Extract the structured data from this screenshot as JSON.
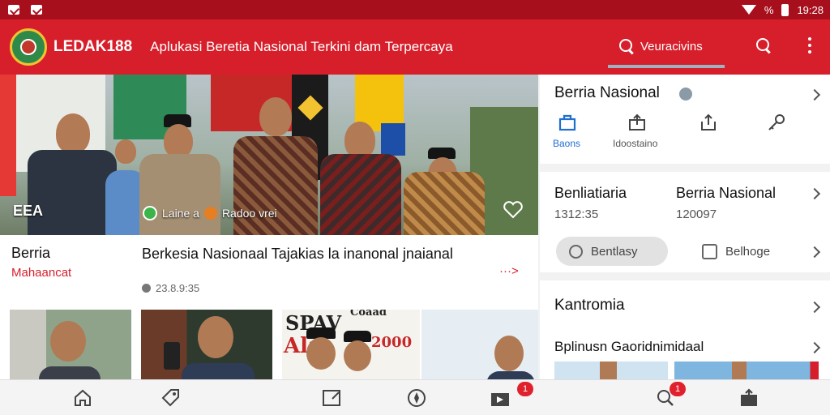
{
  "status_bar": {
    "time": "19:28",
    "network": "%"
  },
  "app_bar": {
    "brand": "LEDAK188",
    "tagline": "Aplukasi Beretia Nasional Terkini dam Terpercaya",
    "search_label": "Veuracivins"
  },
  "hero": {
    "badge": "EEA",
    "chip_label": "Laine a",
    "chip_label_2": "Radoo vrei"
  },
  "headline": {
    "category_title": "Berria",
    "category_sub": "Mahaancat",
    "title": "Berkesia Nasionaal Tajakias la inanonal jnaianal",
    "date": "23.8.9:35",
    "more": "···>"
  },
  "thumbnails": {
    "poster_line1": "SPAV",
    "poster_line2": "Ala",
    "poster_line3": "Coaad",
    "poster_line4": "2000"
  },
  "panel": {
    "section1": {
      "title": "Berria Nasional",
      "icons": [
        {
          "label": "Baons",
          "icon": "home-icon"
        },
        {
          "label": "Idoostaino",
          "icon": "share-icon"
        },
        {
          "label": "",
          "icon": "upload-icon"
        },
        {
          "label": "",
          "icon": "key-icon"
        }
      ]
    },
    "section2": {
      "stat1_title": "Benliatiaria",
      "stat1_value": "1312:35",
      "stat2_title": "Berria Nasional",
      "stat2_value": "120097",
      "chip1": "Bentlasy",
      "chip2": "Belhoge"
    },
    "section3": {
      "title": "Kantromia",
      "subtitle": "Bplinusn Gaoridnimidaal"
    }
  },
  "bottom_nav": {
    "items": [
      {
        "icon": "home-icon"
      },
      {
        "icon": "tag-icon"
      },
      {
        "icon": "edit-icon"
      },
      {
        "icon": "compass-icon"
      },
      {
        "icon": "video-icon",
        "badge": "1"
      },
      {
        "icon": "search-icon",
        "badge": "1"
      },
      {
        "icon": "profile-icon"
      }
    ]
  },
  "colors": {
    "brand_red": "#d71f2b",
    "status_red": "#a80f1c"
  }
}
